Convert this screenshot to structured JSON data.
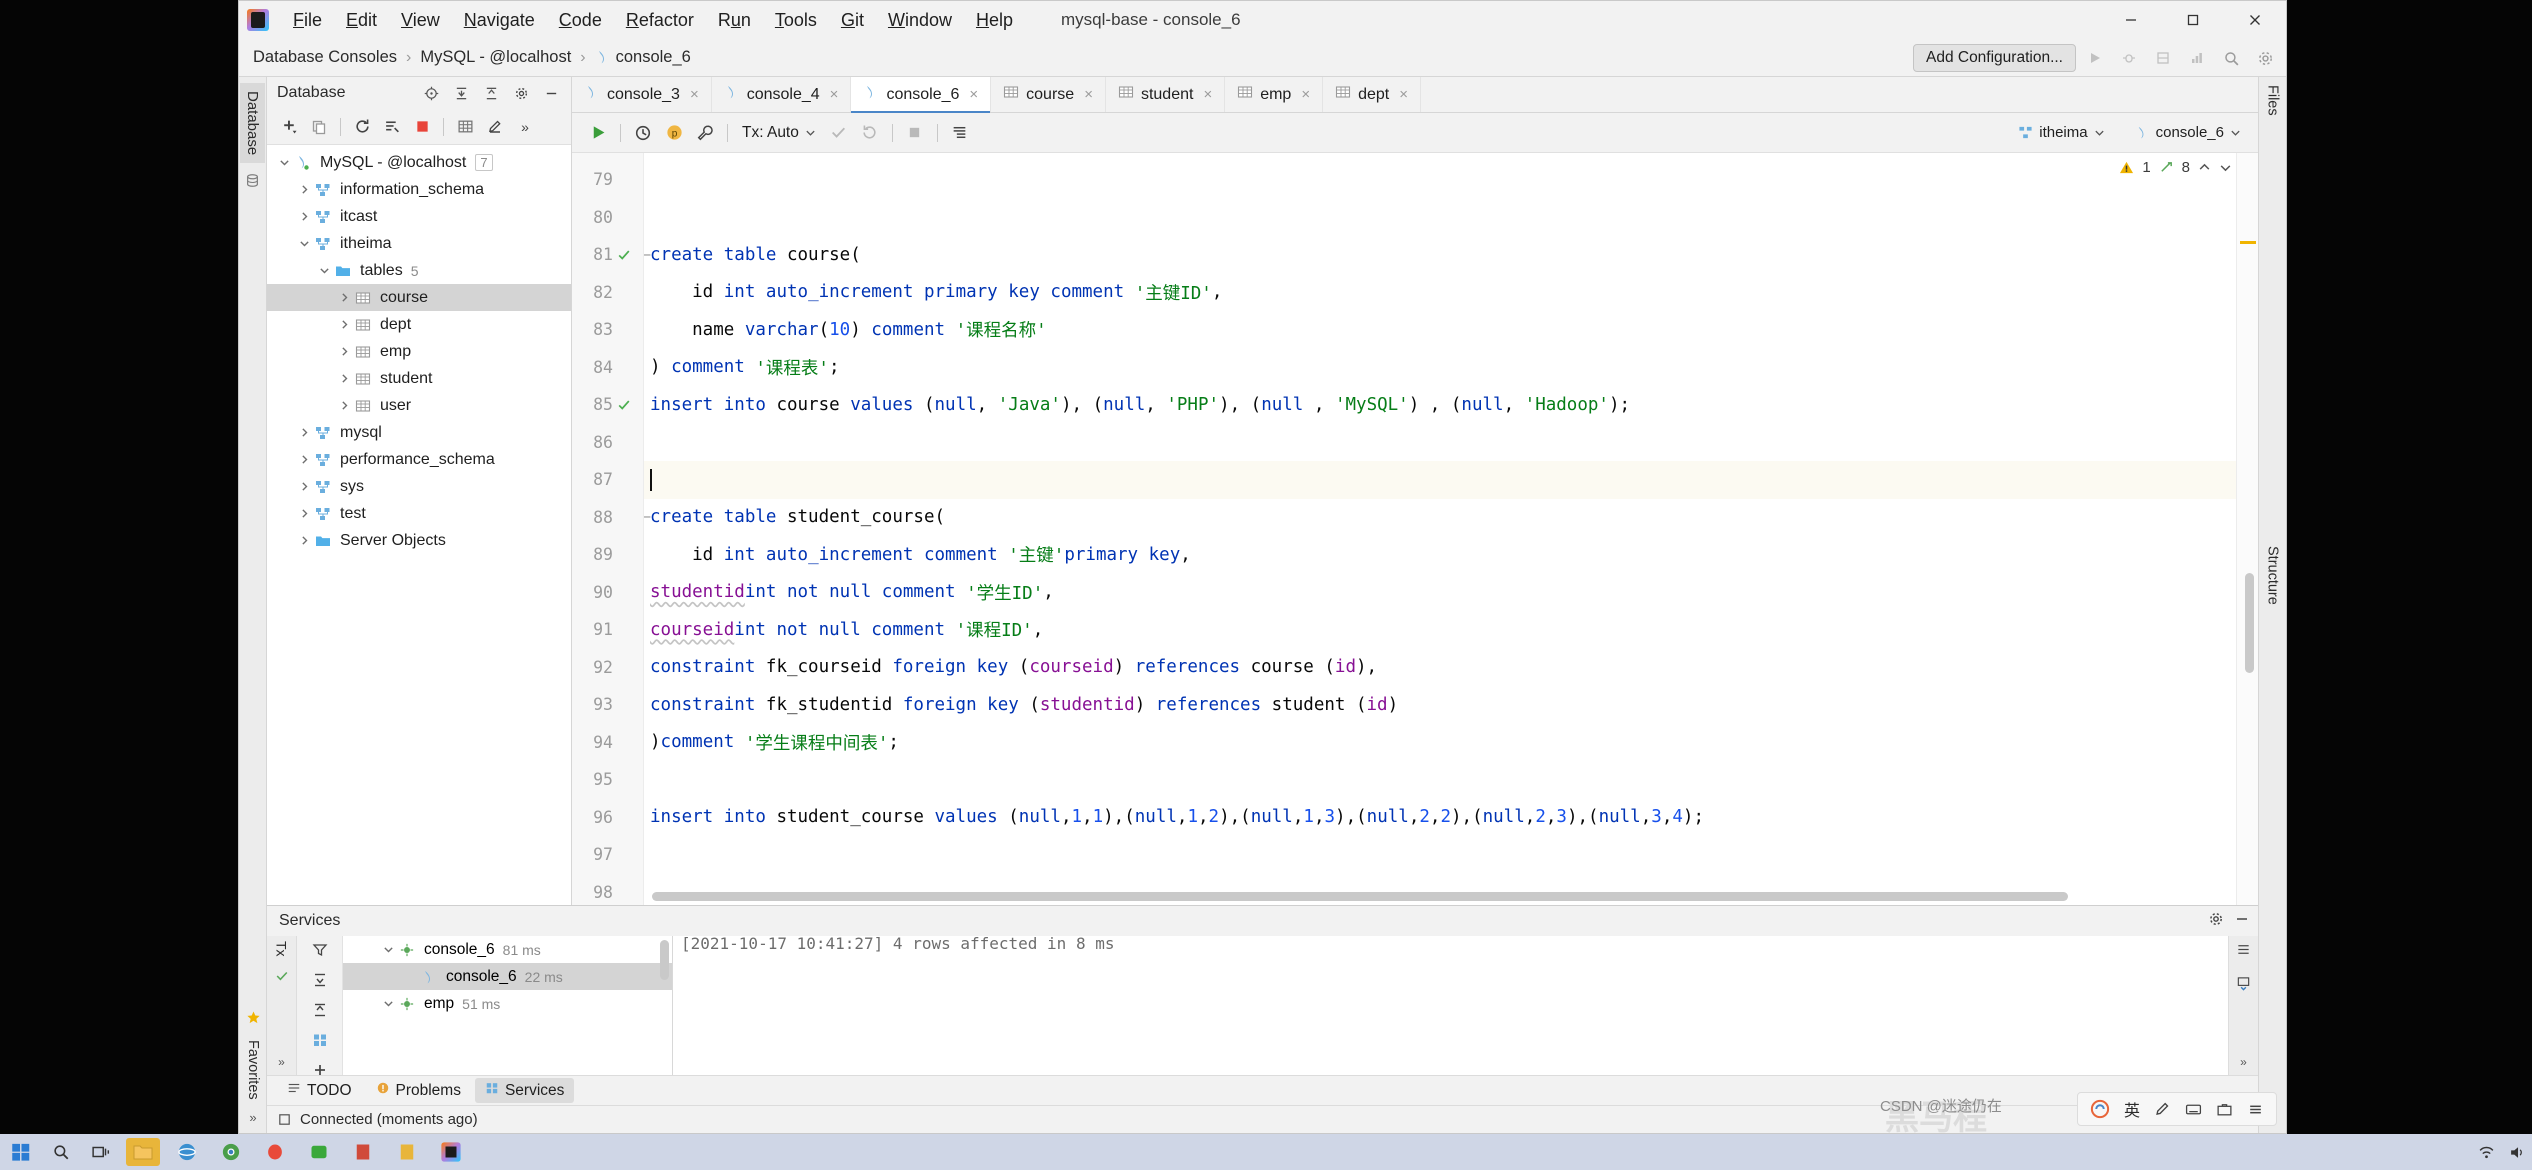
{
  "window": {
    "title": "mysql-base - console_6",
    "minimize_icon": "minimize-icon",
    "maximize_icon": "maximize-icon",
    "close_icon": "close-icon"
  },
  "menu": {
    "items": [
      "File",
      "Edit",
      "View",
      "Navigate",
      "Code",
      "Refactor",
      "Run",
      "Tools",
      "Git",
      "Window",
      "Help"
    ]
  },
  "navbar": {
    "breadcrumbs": [
      "Database Consoles",
      "MySQL - @localhost",
      "console_6"
    ],
    "add_configuration": "Add Configuration...",
    "icons": [
      "run-icon",
      "debug-icon",
      "coverage-icon",
      "profile-icon",
      "search-everywhere-icon",
      "settings-icon"
    ]
  },
  "left_stripe": {
    "tab_label": "Database",
    "bottom_labels": [
      "Favorites"
    ]
  },
  "right_stripe": {
    "labels": [
      "Files",
      "Structure"
    ]
  },
  "database_panel": {
    "title": "Database",
    "toolbar_icons": [
      "add-icon",
      "copy-icon",
      "refresh-icon",
      "sync-icon",
      "stop-icon",
      "table-icon",
      "edit-icon",
      "more-icon"
    ],
    "header_icons": [
      "locate-icon",
      "expand-all-icon",
      "collapse-all-icon",
      "settings-icon",
      "hide-icon"
    ],
    "tree": [
      {
        "label": "MySQL - @localhost",
        "level": 0,
        "arrow": "down",
        "icon": "datasource-icon",
        "badge": "7",
        "selected": false
      },
      {
        "label": "information_schema",
        "level": 1,
        "arrow": "right",
        "icon": "schema-icon",
        "badge": "",
        "selected": false
      },
      {
        "label": "itcast",
        "level": 1,
        "arrow": "right",
        "icon": "schema-icon",
        "badge": "",
        "selected": false
      },
      {
        "label": "itheima",
        "level": 1,
        "arrow": "down",
        "icon": "schema-icon",
        "badge": "",
        "selected": false
      },
      {
        "label": "tables",
        "level": 2,
        "arrow": "down",
        "icon": "folder-icon",
        "badge": "5",
        "selected": false
      },
      {
        "label": "course",
        "level": 3,
        "arrow": "right",
        "icon": "table-icon",
        "badge": "",
        "selected": true
      },
      {
        "label": "dept",
        "level": 3,
        "arrow": "right",
        "icon": "table-icon",
        "badge": "",
        "selected": false
      },
      {
        "label": "emp",
        "level": 3,
        "arrow": "right",
        "icon": "table-icon",
        "badge": "",
        "selected": false
      },
      {
        "label": "student",
        "level": 3,
        "arrow": "right",
        "icon": "table-icon",
        "badge": "",
        "selected": false
      },
      {
        "label": "user",
        "level": 3,
        "arrow": "right",
        "icon": "table-icon",
        "badge": "",
        "selected": false
      },
      {
        "label": "mysql",
        "level": 1,
        "arrow": "right",
        "icon": "schema-icon",
        "badge": "",
        "selected": false
      },
      {
        "label": "performance_schema",
        "level": 1,
        "arrow": "right",
        "icon": "schema-icon",
        "badge": "",
        "selected": false
      },
      {
        "label": "sys",
        "level": 1,
        "arrow": "right",
        "icon": "schema-icon",
        "badge": "",
        "selected": false
      },
      {
        "label": "test",
        "level": 1,
        "arrow": "right",
        "icon": "schema-icon",
        "badge": "",
        "selected": false
      },
      {
        "label": "Server Objects",
        "level": 1,
        "arrow": "right",
        "icon": "folder-icon",
        "badge": "",
        "selected": false
      }
    ]
  },
  "editor_tabs": [
    {
      "label": "console_3",
      "icon": "console-icon",
      "active": false
    },
    {
      "label": "console_4",
      "icon": "console-icon",
      "active": false
    },
    {
      "label": "console_6",
      "icon": "console-icon",
      "active": true
    },
    {
      "label": "course",
      "icon": "table-icon",
      "active": false
    },
    {
      "label": "student",
      "icon": "table-icon",
      "active": false
    },
    {
      "label": "emp",
      "icon": "table-icon",
      "active": false
    },
    {
      "label": "dept",
      "icon": "table-icon",
      "active": false
    }
  ],
  "editor_toolbar": {
    "run_icon": "run-icon",
    "history_icon": "history-icon",
    "params_icon": "parameters-icon",
    "wrench_icon": "wrench-icon",
    "tx_label": "Tx: Auto",
    "commit_icon": "commit-icon",
    "rollback_icon": "rollback-icon",
    "stop_icon": "stop-icon",
    "output_icon": "output-icon",
    "schema_chip": "itheima",
    "console_chip": "console_6"
  },
  "inspection": {
    "warning_count": "1",
    "weak_warning_count": "8",
    "warning_icon": "warning-triangle-icon",
    "weak_icon": "weak-warning-icon",
    "up_icon": "chevron-up-icon",
    "down_icon": "chevron-down-icon"
  },
  "code": {
    "lines": [
      {
        "num": "79",
        "mark": "",
        "tokens": []
      },
      {
        "num": "80",
        "mark": "",
        "tokens": []
      },
      {
        "num": "81",
        "mark": "check",
        "fold": true,
        "tokens": [
          {
            "t": "create ",
            "c": "kw"
          },
          {
            "t": "table ",
            "c": "kw"
          },
          {
            "t": "course(",
            "c": ""
          }
        ]
      },
      {
        "num": "82",
        "mark": "",
        "tokens": [
          {
            "t": "    id ",
            "c": ""
          },
          {
            "t": "int ",
            "c": "kw"
          },
          {
            "t": "auto_increment ",
            "c": "kw"
          },
          {
            "t": "primary key ",
            "c": "kw"
          },
          {
            "t": "comment ",
            "c": "kw"
          },
          {
            "t": "'主键ID'",
            "c": "str"
          },
          {
            "t": ",",
            "c": ""
          }
        ]
      },
      {
        "num": "83",
        "mark": "",
        "tokens": [
          {
            "t": "    name ",
            "c": ""
          },
          {
            "t": "varchar",
            "c": "kw"
          },
          {
            "t": "(",
            "c": ""
          },
          {
            "t": "10",
            "c": "num"
          },
          {
            "t": ") ",
            "c": ""
          },
          {
            "t": "comment ",
            "c": "kw"
          },
          {
            "t": "'课程名称'",
            "c": "str"
          }
        ]
      },
      {
        "num": "84",
        "mark": "",
        "tokens": [
          {
            "t": ") ",
            "c": ""
          },
          {
            "t": "comment ",
            "c": "kw"
          },
          {
            "t": "'课程表'",
            "c": "str"
          },
          {
            "t": ";",
            "c": ""
          }
        ]
      },
      {
        "num": "85",
        "mark": "check",
        "tokens": [
          {
            "t": "insert into ",
            "c": "kw"
          },
          {
            "t": "course ",
            "c": ""
          },
          {
            "t": "values ",
            "c": "kw"
          },
          {
            "t": "(",
            "c": ""
          },
          {
            "t": "null",
            "c": "kw"
          },
          {
            "t": ", ",
            "c": ""
          },
          {
            "t": "'Java'",
            "c": "str"
          },
          {
            "t": "), (",
            "c": ""
          },
          {
            "t": "null",
            "c": "kw"
          },
          {
            "t": ", ",
            "c": ""
          },
          {
            "t": "'PHP'",
            "c": "str"
          },
          {
            "t": "), (",
            "c": ""
          },
          {
            "t": "null ",
            "c": "kw"
          },
          {
            "t": ", ",
            "c": ""
          },
          {
            "t": "'MySQL'",
            "c": "str"
          },
          {
            "t": ") , (",
            "c": ""
          },
          {
            "t": "null",
            "c": "kw"
          },
          {
            "t": ", ",
            "c": ""
          },
          {
            "t": "'Hadoop'",
            "c": "str"
          },
          {
            "t": ");",
            "c": ""
          }
        ]
      },
      {
        "num": "86",
        "mark": "",
        "tokens": []
      },
      {
        "num": "87",
        "mark": "",
        "current": true,
        "caret": true,
        "tokens": []
      },
      {
        "num": "88",
        "mark": "",
        "fold": true,
        "tokens": [
          {
            "t": "create ",
            "c": "kw"
          },
          {
            "t": "table ",
            "c": "kw"
          },
          {
            "t": "student_course(",
            "c": ""
          }
        ]
      },
      {
        "num": "89",
        "mark": "",
        "tokens": [
          {
            "t": "    id ",
            "c": ""
          },
          {
            "t": "int ",
            "c": "kw"
          },
          {
            "t": "auto_increment ",
            "c": "kw"
          },
          {
            "t": "comment ",
            "c": "kw"
          },
          {
            "t": "'主键'",
            "c": "str"
          },
          {
            "t": " ",
            "c": ""
          },
          {
            "t": "primary key",
            "c": "kw"
          },
          {
            "t": ",",
            "c": ""
          }
        ]
      },
      {
        "num": "90",
        "mark": "",
        "tokens": [
          {
            "t": "    ",
            "c": ""
          },
          {
            "t": "studentid",
            "c": "colw"
          },
          {
            "t": " ",
            "c": ""
          },
          {
            "t": "int not null ",
            "c": "kw"
          },
          {
            "t": "comment ",
            "c": "kw"
          },
          {
            "t": "'学生ID'",
            "c": "str"
          },
          {
            "t": ",",
            "c": ""
          }
        ]
      },
      {
        "num": "91",
        "mark": "",
        "tokens": [
          {
            "t": "    ",
            "c": ""
          },
          {
            "t": "courseid",
            "c": "colw"
          },
          {
            "t": "  ",
            "c": ""
          },
          {
            "t": "int not null ",
            "c": "kw"
          },
          {
            "t": "comment ",
            "c": "kw"
          },
          {
            "t": "'课程ID'",
            "c": "str"
          },
          {
            "t": ",",
            "c": ""
          }
        ]
      },
      {
        "num": "92",
        "mark": "",
        "tokens": [
          {
            "t": "    ",
            "c": ""
          },
          {
            "t": "constraint ",
            "c": "kw"
          },
          {
            "t": "fk_courseid ",
            "c": ""
          },
          {
            "t": "foreign key ",
            "c": "kw"
          },
          {
            "t": "(",
            "c": ""
          },
          {
            "t": "courseid",
            "c": "col"
          },
          {
            "t": ") ",
            "c": ""
          },
          {
            "t": "references ",
            "c": "kw"
          },
          {
            "t": "course (",
            "c": ""
          },
          {
            "t": "id",
            "c": "col"
          },
          {
            "t": "),",
            "c": ""
          }
        ]
      },
      {
        "num": "93",
        "mark": "",
        "tokens": [
          {
            "t": "    ",
            "c": ""
          },
          {
            "t": "constraint ",
            "c": "kw"
          },
          {
            "t": "fk_studentid ",
            "c": ""
          },
          {
            "t": "foreign key ",
            "c": "kw"
          },
          {
            "t": "(",
            "c": ""
          },
          {
            "t": "studentid",
            "c": "col"
          },
          {
            "t": ") ",
            "c": ""
          },
          {
            "t": "references ",
            "c": "kw"
          },
          {
            "t": "student (",
            "c": ""
          },
          {
            "t": "id",
            "c": "col"
          },
          {
            "t": ")",
            "c": ""
          }
        ]
      },
      {
        "num": "94",
        "mark": "",
        "tokens": [
          {
            "t": ")",
            "c": ""
          },
          {
            "t": "comment ",
            "c": "kw"
          },
          {
            "t": "'学生课程中间表'",
            "c": "str"
          },
          {
            "t": ";",
            "c": ""
          }
        ]
      },
      {
        "num": "95",
        "mark": "",
        "tokens": []
      },
      {
        "num": "96",
        "mark": "",
        "tokens": [
          {
            "t": "insert into ",
            "c": "kw"
          },
          {
            "t": "student_course ",
            "c": ""
          },
          {
            "t": "values ",
            "c": "kw"
          },
          {
            "t": "(",
            "c": ""
          },
          {
            "t": "null",
            "c": "kw"
          },
          {
            "t": ",",
            "c": ""
          },
          {
            "t": "1",
            "c": "num"
          },
          {
            "t": ",",
            "c": ""
          },
          {
            "t": "1",
            "c": "num"
          },
          {
            "t": "),(",
            "c": ""
          },
          {
            "t": "null",
            "c": "kw"
          },
          {
            "t": ",",
            "c": ""
          },
          {
            "t": "1",
            "c": "num"
          },
          {
            "t": ",",
            "c": ""
          },
          {
            "t": "2",
            "c": "num"
          },
          {
            "t": "),(",
            "c": ""
          },
          {
            "t": "null",
            "c": "kw"
          },
          {
            "t": ",",
            "c": ""
          },
          {
            "t": "1",
            "c": "num"
          },
          {
            "t": ",",
            "c": ""
          },
          {
            "t": "3",
            "c": "num"
          },
          {
            "t": "),(",
            "c": ""
          },
          {
            "t": "null",
            "c": "kw"
          },
          {
            "t": ",",
            "c": ""
          },
          {
            "t": "2",
            "c": "num"
          },
          {
            "t": ",",
            "c": ""
          },
          {
            "t": "2",
            "c": "num"
          },
          {
            "t": "),(",
            "c": ""
          },
          {
            "t": "null",
            "c": "kw"
          },
          {
            "t": ",",
            "c": ""
          },
          {
            "t": "2",
            "c": "num"
          },
          {
            "t": ",",
            "c": ""
          },
          {
            "t": "3",
            "c": "num"
          },
          {
            "t": "),(",
            "c": ""
          },
          {
            "t": "null",
            "c": "kw"
          },
          {
            "t": ",",
            "c": ""
          },
          {
            "t": "3",
            "c": "num"
          },
          {
            "t": ",",
            "c": ""
          },
          {
            "t": "4",
            "c": "num"
          },
          {
            "t": ");",
            "c": ""
          }
        ]
      },
      {
        "num": "97",
        "mark": "",
        "tokens": []
      },
      {
        "num": "98",
        "mark": "",
        "tokens": []
      }
    ]
  },
  "services": {
    "title": "Services",
    "settings_icon": "gear-icon",
    "hide_icon": "hide-icon",
    "rail_label": "Tx",
    "toolbar_icons": [
      "filter-icon",
      "expand-icon",
      "collapse-icon",
      "group-icon",
      "add-icon"
    ],
    "tree": [
      {
        "label": "console_6",
        "time": "81 ms",
        "level": 1,
        "arrow": "down",
        "icon": "session-icon",
        "selected": false
      },
      {
        "label": "console_6",
        "time": "22 ms",
        "level": 2,
        "arrow": "",
        "icon": "console-icon",
        "selected": true
      },
      {
        "label": "emp",
        "time": "51 ms",
        "level": 1,
        "arrow": "down",
        "icon": "session-icon",
        "selected": false
      }
    ],
    "output": "[2021-10-17 10:41:27] 4 rows affected in 8 ms"
  },
  "bottom_tabs": [
    {
      "label": "TODO",
      "icon": "todo-icon",
      "active": false
    },
    {
      "label": "Problems",
      "icon": "problems-icon",
      "active": false
    },
    {
      "label": "Services",
      "icon": "services-icon",
      "active": true
    }
  ],
  "statusbar": {
    "message": "Connected (moments ago)",
    "icon": "plug-icon"
  },
  "ime": {
    "logo": "sogou-icon",
    "mode": "英",
    "items": [
      "pen-icon",
      "keyboard-icon",
      "toolbox-icon",
      "menu-icon"
    ]
  },
  "taskbar": {
    "start_icon": "windows-start-icon",
    "search_icon": "search-icon",
    "task_view_icon": "task-view-icon",
    "apps": [
      "explorer-icon",
      "ie-icon",
      "chrome-icon",
      "qq-icon",
      "wechat-icon",
      "pdf-icon",
      "notes-icon",
      "idea-icon"
    ],
    "tray_time": "",
    "tray_icons": [
      "network-icon",
      "volume-icon",
      "ime-icon"
    ]
  },
  "watermark": {
    "text": "CSDN @迷途仍在",
    "logo": "黑马程"
  },
  "colors": {
    "accent": "#4a86c8",
    "keyword": "#0033b3",
    "string": "#067d17",
    "number": "#1750eb",
    "column": "#871094",
    "selection": "#d4d4d4",
    "current_line": "#fcfaf2"
  }
}
